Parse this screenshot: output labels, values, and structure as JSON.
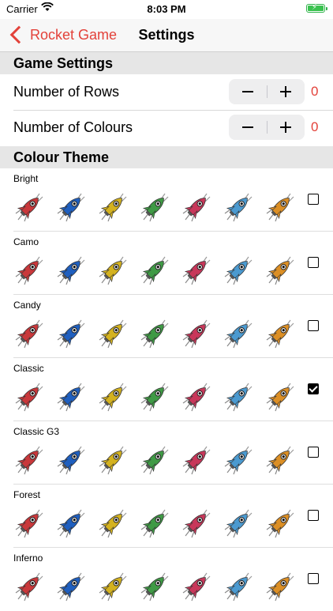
{
  "status_bar": {
    "carrier": "Carrier",
    "time": "8:03 PM"
  },
  "nav": {
    "back_label": "Rocket Game",
    "title": "Settings",
    "accent": "#e3423a"
  },
  "game_settings": {
    "header": "Game Settings",
    "rows": [
      {
        "label": "Number of Rows",
        "value": "0"
      },
      {
        "label": "Number of Colours",
        "value": "0"
      }
    ]
  },
  "colour_theme": {
    "header": "Colour Theme",
    "rocket_colors": [
      "#c9383b",
      "#1f5fbf",
      "#d4b21f",
      "#3f9a45",
      "#c8375a",
      "#4b9ad0",
      "#dc8f25"
    ],
    "themes": [
      {
        "name": "Bright",
        "selected": false
      },
      {
        "name": "Camo",
        "selected": false
      },
      {
        "name": "Candy",
        "selected": false
      },
      {
        "name": "Classic",
        "selected": true
      },
      {
        "name": "Classic G3",
        "selected": false
      },
      {
        "name": "Forest",
        "selected": false
      },
      {
        "name": "Inferno",
        "selected": false
      }
    ]
  }
}
